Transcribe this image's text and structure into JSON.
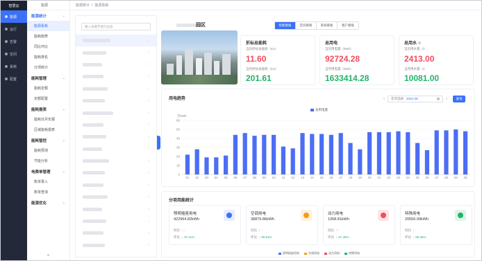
{
  "nav": {
    "brand": "智慧云",
    "items": [
      {
        "label": "能源",
        "icon": "energy-icon",
        "active": true
      },
      {
        "label": "运行",
        "icon": "run-icon"
      },
      {
        "label": "告警",
        "icon": "alarm-icon"
      },
      {
        "label": "空间",
        "icon": "space-icon"
      },
      {
        "label": "系统",
        "icon": "system-icon"
      },
      {
        "label": "配置",
        "icon": "config-icon"
      }
    ]
  },
  "submenu": {
    "header": "能源",
    "groups": [
      {
        "label": "能源统计",
        "blue": true,
        "items": [
          {
            "label": "能源看板",
            "active": true
          },
          {
            "label": "能耗趋势"
          },
          {
            "label": "同比环比"
          },
          {
            "label": "能耗排名"
          },
          {
            "label": "分项统计"
          }
        ]
      },
      {
        "label": "能耗管理",
        "items": [
          {
            "label": "能耗定额"
          },
          {
            "label": "定额配置"
          }
        ]
      },
      {
        "label": "能耗报表",
        "items": [
          {
            "label": "能耗日月年报"
          },
          {
            "label": "区域能耗报表"
          }
        ]
      },
      {
        "label": "能耗管控",
        "items": [
          {
            "label": "能耗预测"
          },
          {
            "label": "节能分析"
          }
        ]
      },
      {
        "label": "电费单管理",
        "items": [
          {
            "label": "账单录入"
          },
          {
            "label": "账单查询"
          }
        ]
      },
      {
        "label": "能源优化",
        "items": []
      }
    ],
    "collapse": "«"
  },
  "breadcrumb": [
    "能源统计",
    "能源看板"
  ],
  "tree": {
    "search_placeholder": "输入关键字进行过滤",
    "rows": 18
  },
  "park": {
    "title": "园区"
  },
  "tabs": [
    "智能看板",
    "空间看板",
    "系统看板",
    "租户看板"
  ],
  "kpi": {
    "energy": {
      "title": "折标总能耗",
      "today_label": "当日折标总能耗（tce）",
      "today_value": "11.60",
      "month_label": "当月折标总能耗（tce）",
      "month_value": "201.61"
    },
    "power": {
      "title": "总用电",
      "today_label": "当日用电量（kWh）",
      "today_value": "92724.28",
      "month_label": "当月用电量（kWh）",
      "month_value": "1633414.28"
    },
    "water": {
      "title": "总用水",
      "today_label": "当日用水量（t）",
      "today_value": "2413.00",
      "month_label": "当月用水量（t）",
      "month_value": "10081.00"
    }
  },
  "chart_panel": {
    "title": "用电趋势",
    "date_label": "年月选择",
    "date_value": "2022-09",
    "query_button": "查询",
    "prev": "‹",
    "next": "›"
  },
  "chart_data": {
    "type": "bar",
    "ylabel": "万kWh",
    "legend": "总用电量",
    "ylim": [
      0,
      60
    ],
    "yticks": [
      0,
      10,
      20,
      30,
      40,
      50,
      60
    ],
    "categories": [
      "01",
      "02",
      "03",
      "04",
      "05",
      "06",
      "07",
      "08",
      "09",
      "10",
      "11",
      "12",
      "13",
      "14",
      "15",
      "16",
      "17",
      "18",
      "19",
      "20",
      "21",
      "22",
      "23",
      "24",
      "25",
      "26",
      "27",
      "28",
      "29",
      "30"
    ],
    "values": [
      22,
      28,
      19,
      19,
      21,
      44,
      46,
      43,
      44,
      44,
      31,
      29,
      46,
      45,
      45,
      44,
      46,
      35,
      28,
      47,
      47,
      47,
      48,
      47,
      35,
      27,
      49,
      49,
      50,
      48
    ],
    "color": "#4c6ef5"
  },
  "category_panel": {
    "title": "分项用能统计",
    "cards": [
      {
        "name": "照明插座用电",
        "value": "422964.82kWh",
        "icon": "light-icon",
        "icon_color": "#3a71f7",
        "icon_bg": "#e6edff",
        "yoy_label": "同比",
        "yoy": "-",
        "mom_label": "环比",
        "mom": "87.11%"
      },
      {
        "name": "空调用电",
        "value": "38879.86kWh",
        "icon": "aircon-icon",
        "icon_color": "#f59b1b",
        "icon_bg": "#fff1dc",
        "yoy_label": "同比",
        "yoy": "-",
        "mom_label": "环比",
        "mom": "99.81%"
      },
      {
        "name": "动力用电",
        "value": "1358.81kWh",
        "icon": "power-icon",
        "icon_color": "#f04d5e",
        "icon_bg": "#ffe4e7",
        "yoy_label": "同比",
        "yoy": "-",
        "mom_label": "环比",
        "mom": "87.45%"
      },
      {
        "name": "特殊用电",
        "value": "20556.09kWh",
        "icon": "special-icon",
        "icon_color": "#22b36a",
        "icon_bg": "#dcf5e8",
        "yoy_label": "同比",
        "yoy": "-",
        "mom_label": "环比",
        "mom": "86.36%"
      }
    ],
    "legend": [
      {
        "label": "照明插座用电",
        "color": "#4c6ef5"
      },
      {
        "label": "空调用电",
        "color": "#f59b1b"
      },
      {
        "label": "动力用电",
        "color": "#f04d5e"
      },
      {
        "label": "特殊用电",
        "color": "#22b36a"
      }
    ]
  }
}
